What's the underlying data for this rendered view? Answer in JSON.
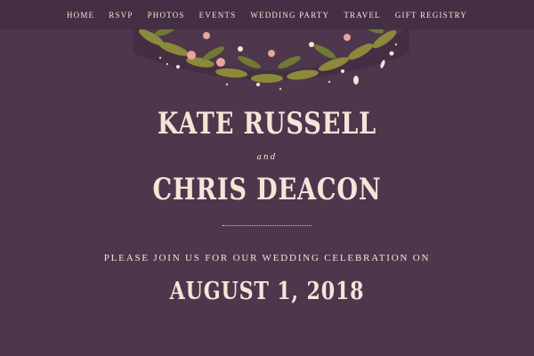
{
  "nav": {
    "items": [
      {
        "label": "HOME"
      },
      {
        "label": "RSVP"
      },
      {
        "label": "PHOTOS"
      },
      {
        "label": "EVENTS"
      },
      {
        "label": "WEDDING PARTY"
      },
      {
        "label": "TRAVEL"
      },
      {
        "label": "GIFT REGISTRY"
      }
    ]
  },
  "hero": {
    "name1": "KATE RUSSELL",
    "connector": "and",
    "name2": "CHRIS DEACON",
    "invite_text": "PLEASE JOIN US FOR OUR WEDDING CELEBRATION ON",
    "date": "AUGUST 1, 2018"
  },
  "colors": {
    "background": "#4e364c",
    "nav_background": "#452f44",
    "text": "#f3e6d8"
  },
  "icons": {
    "wreath": "floral-wreath-illustration"
  }
}
